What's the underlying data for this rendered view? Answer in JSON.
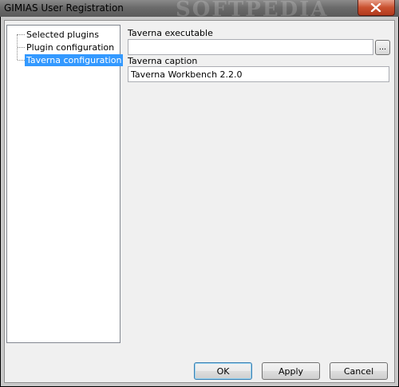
{
  "window": {
    "title": "GIMIAS User Registration",
    "watermark": "SOFTPEDIA"
  },
  "tree": {
    "items": [
      {
        "label": "Selected plugins",
        "selected": false
      },
      {
        "label": "Plugin configuration",
        "selected": false
      },
      {
        "label": "Taverna configuration",
        "selected": true
      }
    ]
  },
  "form": {
    "executable_label": "Taverna executable",
    "executable_value": "",
    "browse_label": "...",
    "caption_label": "Taverna caption",
    "caption_value": "Taverna Workbench 2.2.0"
  },
  "buttons": {
    "ok": "OK",
    "apply": "Apply",
    "cancel": "Cancel"
  },
  "colors": {
    "selection": "#3399ff",
    "close_button": "#c9502f"
  }
}
